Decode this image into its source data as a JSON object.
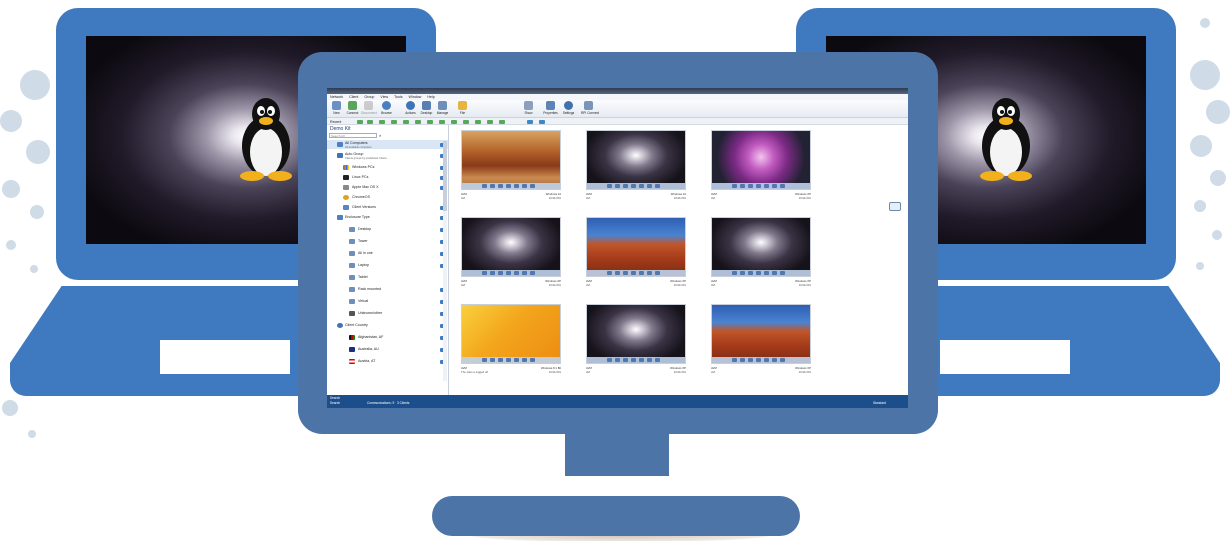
{
  "colors": {
    "laptop_blue": "#3f79bf",
    "monitor_blue": "#4d74a7",
    "app_status_bar": "#1d4e8c",
    "dot_gray": "#cfdbe6"
  },
  "app": {
    "menu": [
      "Network",
      "Client",
      "Group",
      "View",
      "Tools",
      "Window",
      "Help"
    ],
    "toolbar": [
      {
        "label": "New",
        "icon": "new-icon"
      },
      {
        "label": "Connect",
        "icon": "connect-icon"
      },
      {
        "label": "Disconnect",
        "icon": "disconnect-icon"
      },
      {
        "label": "Browse",
        "icon": "browse-icon"
      },
      {
        "label": "Actions",
        "icon": "actions-icon"
      },
      {
        "label": "Desktop",
        "icon": "desktop-icon"
      },
      {
        "label": "Manage",
        "icon": "manage-icon"
      },
      {
        "label": "File",
        "icon": "file-icon"
      },
      {
        "label": "Show",
        "icon": "show-icon"
      },
      {
        "label": "Properties",
        "icon": "properties-icon"
      },
      {
        "label": "Settings",
        "icon": "settings-icon"
      },
      {
        "label": "RPI Connect",
        "icon": "rpi-connect-icon"
      }
    ],
    "recent_label": "Recent",
    "sidebar": {
      "title": "Demo Kit",
      "search_placeholder": "Search All",
      "items": [
        {
          "label": "All Computers",
          "sub": "All available computers"
        },
        {
          "label": "Auto Group",
          "sub": "Clients groups by predefined criteria"
        },
        {
          "label": "Windows PCs",
          "sub": ""
        },
        {
          "label": "Linux PCs",
          "sub": ""
        },
        {
          "label": "Apple Mac OS X",
          "sub": ""
        },
        {
          "label": "ChromeOS",
          "sub": ""
        },
        {
          "label": "Client Versions",
          "sub": ""
        },
        {
          "label": "Enclosure Type",
          "sub": ""
        },
        {
          "label": "Desktop",
          "sub": ""
        },
        {
          "label": "Tower",
          "sub": ""
        },
        {
          "label": "All in one",
          "sub": ""
        },
        {
          "label": "Laptop",
          "sub": ""
        },
        {
          "label": "Tablet",
          "sub": ""
        },
        {
          "label": "Rack mounted",
          "sub": ""
        },
        {
          "label": "Virtual",
          "sub": ""
        },
        {
          "label": "Unknown/other",
          "sub": ""
        },
        {
          "label": "Client Country",
          "sub": ""
        },
        {
          "label": "Afghanistan, AF",
          "sub": ""
        },
        {
          "label": "Australia, AU",
          "sub": ""
        },
        {
          "label": "Austria, AT",
          "sub": ""
        }
      ]
    },
    "status": {
      "search": "Search",
      "left": "Search",
      "middle": "Communications: 9",
      "right_mid": "3 Clients",
      "far_right": "Standard"
    },
    "tiles": [
      {
        "name": "AVM",
        "sub": "AVI",
        "os": "Windows 10",
        "date": "10/11/201",
        "theme": "autumn"
      },
      {
        "name": "AVM",
        "sub": "AVI",
        "os": "Windows 10",
        "date": "10/11/201",
        "theme": "linux"
      },
      {
        "name": "AVM",
        "sub": "AVI",
        "os": "Windows XP",
        "date": "10/11/201",
        "theme": "flower"
      },
      {
        "name": "AVM",
        "sub": "AVI",
        "os": "Windows XP",
        "date": "10/11/201",
        "theme": "linux"
      },
      {
        "name": "AVM",
        "sub": "AVI",
        "os": "Windows XP",
        "date": "10/11/201",
        "theme": "desert"
      },
      {
        "name": "AVM",
        "sub": "AVI",
        "os": "Windows XP",
        "date": "10/11/201",
        "theme": "linux"
      },
      {
        "name": "AVM",
        "sub": "The stars a logged off",
        "os": "Windows 8.1 Bit",
        "date": "10/11/201",
        "theme": "orange"
      },
      {
        "name": "AVM",
        "sub": "AVI",
        "os": "Windows XP",
        "date": "10/11/201",
        "theme": "linux"
      },
      {
        "name": "AVM",
        "sub": "AVI",
        "os": "Windows XP",
        "date": "10/11/201",
        "theme": "desert"
      }
    ]
  }
}
